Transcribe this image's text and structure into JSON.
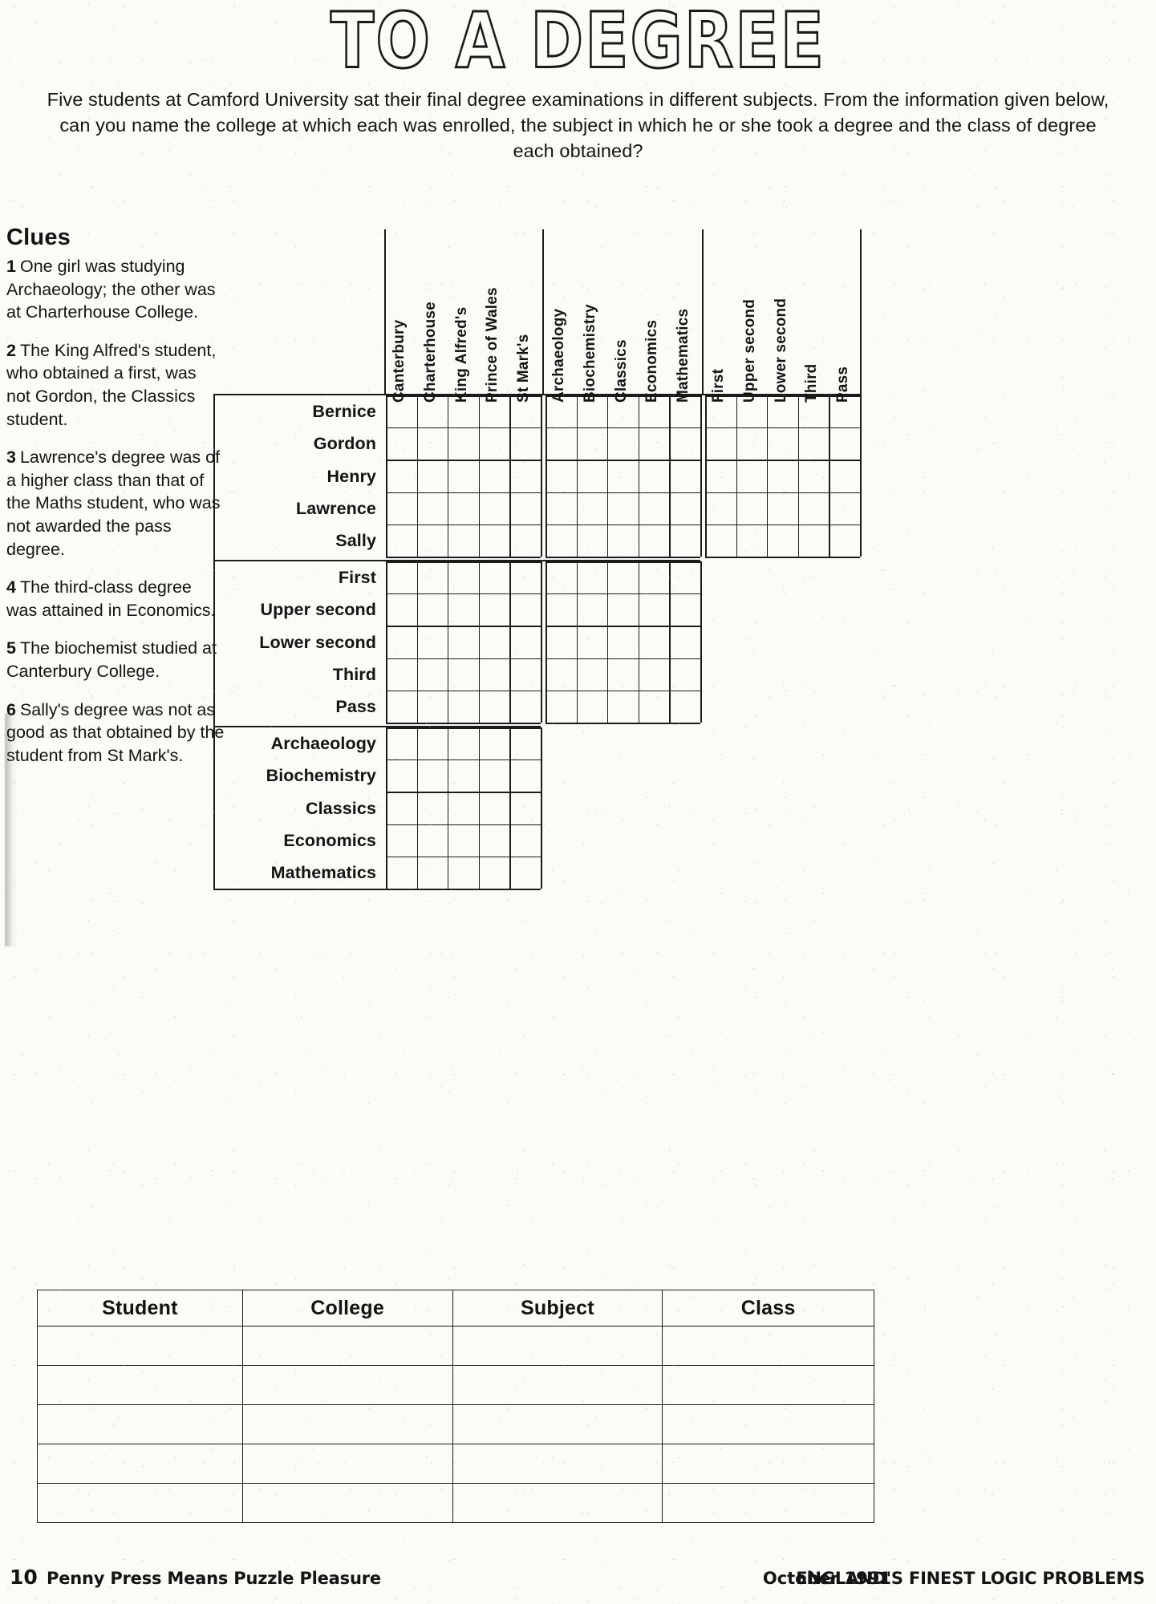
{
  "title": "TO A DEGREE",
  "intro": "Five students at Camford University sat their final degree examinations in different subjects. From the information given below, can you name the college at which each was enrolled, the subject in which he or she took a degree and the class of degree each obtained?",
  "clues_heading": "Clues",
  "clues": [
    {
      "num": "1",
      "text": "One girl was studying Archaeology; the other was at Charterhouse College."
    },
    {
      "num": "2",
      "text": "The King Alfred's student, who obtained a first, was not Gordon, the Classics student."
    },
    {
      "num": "3",
      "text": "Lawrence's degree was of a higher class than that of the Maths student, who was not awarded the pass degree."
    },
    {
      "num": "4",
      "text": "The third-class degree was attained in Economics."
    },
    {
      "num": "5",
      "text": "The biochemist studied at Canterbury College."
    },
    {
      "num": "6",
      "text": "Sally's degree was not as good as that obtained by the student from St Mark's."
    }
  ],
  "grid": {
    "students": [
      "Bernice",
      "Gordon",
      "Henry",
      "Lawrence",
      "Sally"
    ],
    "colleges": [
      "Canterbury",
      "Charterhouse",
      "King Alfred's",
      "Prince of Wales",
      "St Mark's"
    ],
    "subjects": [
      "Archaeology",
      "Biochemistry",
      "Classics",
      "Economics",
      "Mathematics"
    ],
    "classes": [
      "First",
      "Upper second",
      "Lower second",
      "Third",
      "Pass"
    ]
  },
  "answer_table": {
    "headers": [
      "Student",
      "College",
      "Subject",
      "Class"
    ],
    "rows": [
      [
        "",
        "",
        "",
        ""
      ],
      [
        "",
        "",
        "",
        ""
      ],
      [
        "",
        "",
        "",
        ""
      ],
      [
        "",
        "",
        "",
        ""
      ],
      [
        "",
        "",
        "",
        ""
      ]
    ]
  },
  "footer": {
    "page": "10",
    "left": "Penny Press Means Puzzle Pleasure",
    "date": "October 1991",
    "right": "ENGLAND'S FINEST LOGIC PROBLEMS"
  }
}
